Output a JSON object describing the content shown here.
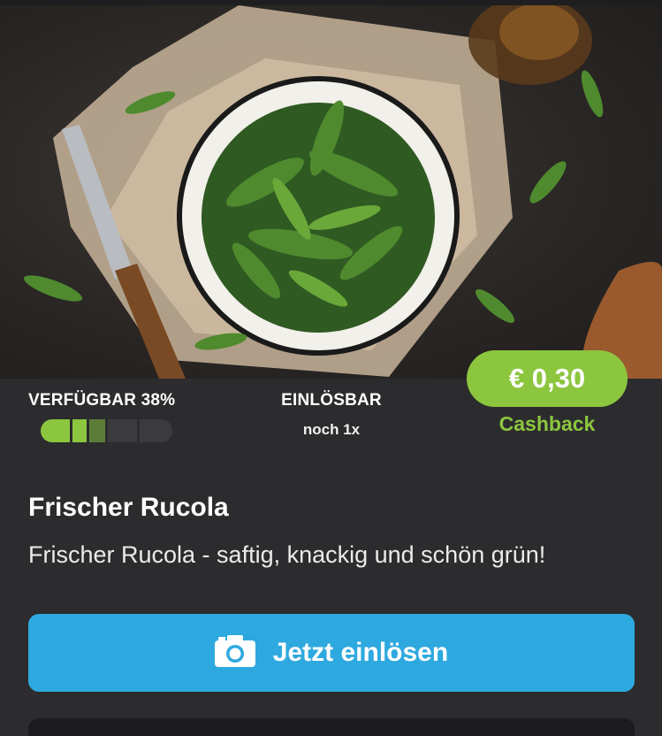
{
  "hero": {
    "image": "arugula-salad-bowl"
  },
  "availability": {
    "label": "VERFÜGBAR 38%",
    "percent": 38
  },
  "redeemable": {
    "label": "EINLÖSBAR",
    "sub": "noch 1x"
  },
  "cashback": {
    "amount": "€ 0,30",
    "label": "Cashback"
  },
  "product": {
    "title": "Frischer Rucola",
    "description": "Frischer Rucola - saftig, knackig und schön grün!"
  },
  "action": {
    "label": "Jetzt einlösen",
    "icon": "camera-icon"
  },
  "colors": {
    "accent_green": "#8cc63f",
    "button_blue": "#2ea9df",
    "background": "#2c2c2e"
  }
}
